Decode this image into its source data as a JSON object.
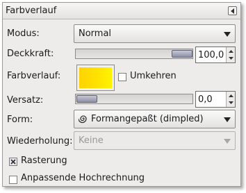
{
  "panel": {
    "title": "Farbverlauf"
  },
  "rows": {
    "mode": {
      "label": "Modus:",
      "value": "Normal"
    },
    "opacity": {
      "label": "Deckkraft:",
      "value": "100,0",
      "fraction": 1.0
    },
    "gradient": {
      "label": "Farbverlauf:",
      "reverse_label": "Umkehren",
      "reverse_checked": false
    },
    "offset": {
      "label": "Versatz:",
      "value": "0,0",
      "fraction": 0.0
    },
    "shape": {
      "label": "Form:",
      "value": "Formangepaßt (dimpled)"
    },
    "repeat": {
      "label": "Wiederholung:",
      "value": "Keine",
      "disabled": true
    }
  },
  "options": {
    "dithering": {
      "label": "Rasterung",
      "checked": true
    },
    "adaptive": {
      "label": "Anpassende Hochrechnung",
      "checked": false
    }
  },
  "colors": {
    "panel_bg": "#edeceb",
    "gradient_start": "#ffd200",
    "gradient_end": "#fff200"
  },
  "icons": {
    "dock": "dock-menu-icon",
    "shape": "shape-spiral-icon",
    "combo_arrow": "chevron-down-icon"
  }
}
